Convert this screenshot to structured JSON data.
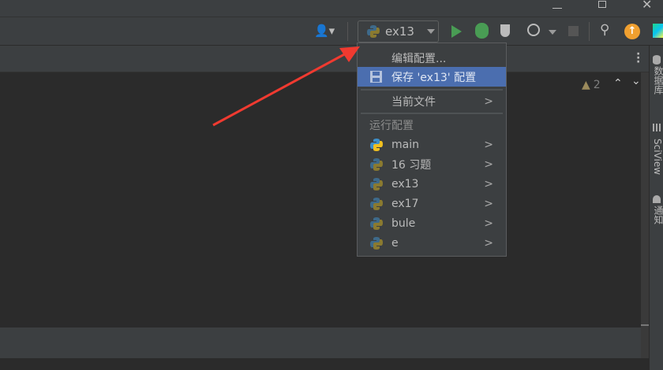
{
  "window": {
    "minimize_icon": "minimize-icon",
    "restore_icon": "restore-icon",
    "close_icon": "close-icon"
  },
  "toolbar": {
    "run_config": "ex13"
  },
  "editor": {
    "warning_count": "2"
  },
  "menu": {
    "edit_config": "编辑配置...",
    "save_config": "保存 'ex13' 配置",
    "current_file": "当前文件",
    "section_header": "运行配置",
    "configs": [
      {
        "label": "main",
        "active": true
      },
      {
        "label": "16 习题"
      },
      {
        "label": "ex13"
      },
      {
        "label": "ex17"
      },
      {
        "label": "bule"
      },
      {
        "label": "e"
      }
    ]
  },
  "right_sidebar": {
    "database": "数据库",
    "sciview": "SciView",
    "notifications": "通知"
  },
  "colors": {
    "selection": "#4b6eaf",
    "run_green": "#499c54",
    "annotation_arrow": "#f03a30"
  }
}
